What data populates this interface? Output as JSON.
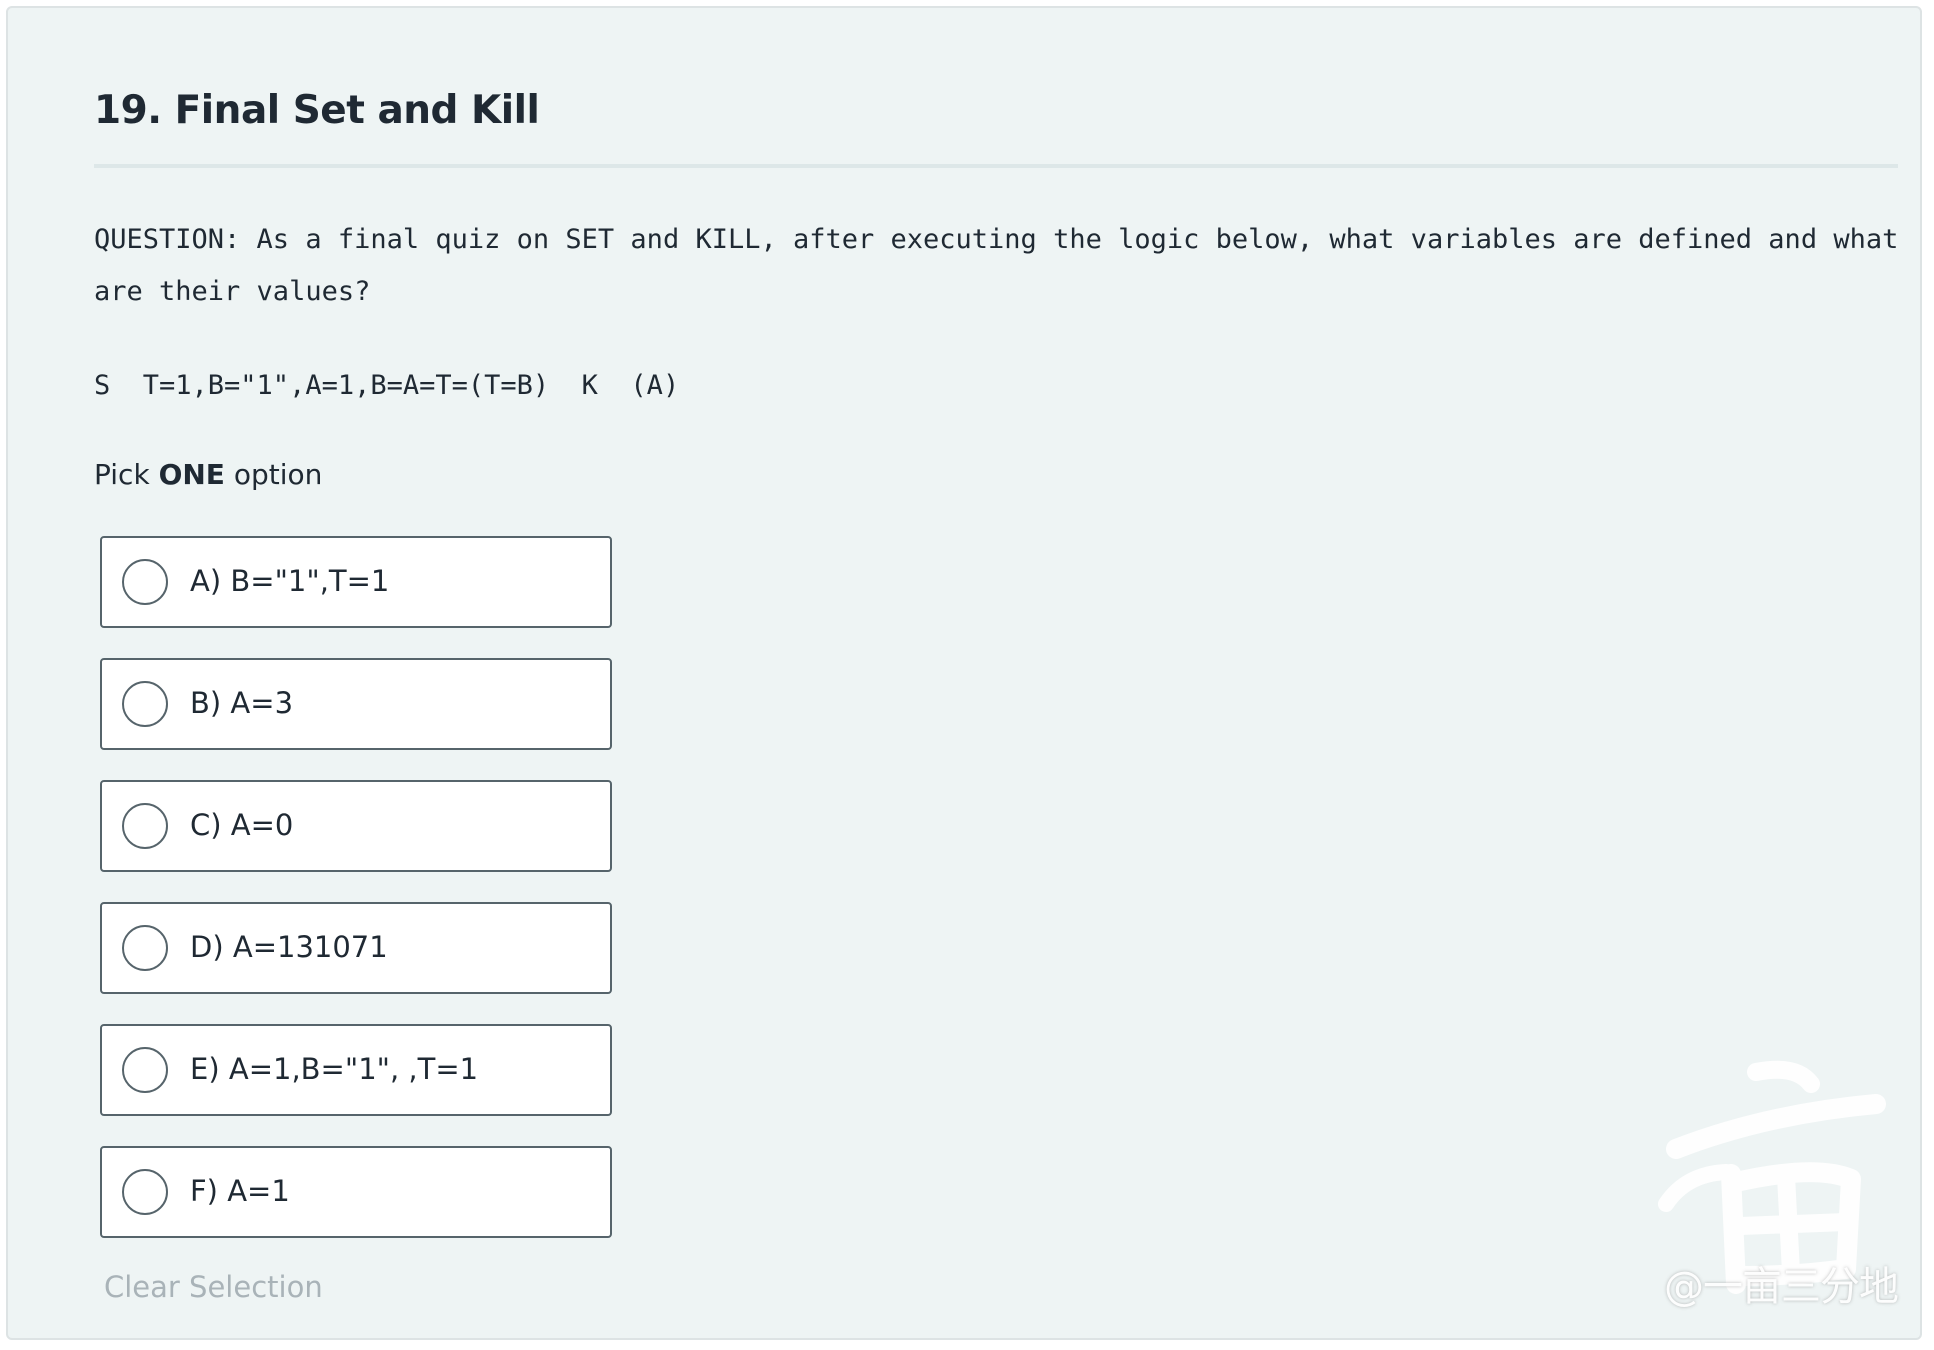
{
  "question": {
    "title": "19. Final Set and Kill",
    "text": "QUESTION: As a final quiz on SET and KILL, after executing the logic below, what variables are defined and what are their values?",
    "code": "S  T=1,B=\"1\",A=1,B=A=T=(T=B)  K  (A)"
  },
  "instructions": {
    "prefix": "Pick ",
    "emphasis": "ONE",
    "suffix": " option"
  },
  "options": [
    {
      "label": "A) B=\"1\",T=1"
    },
    {
      "label": "B) A=3"
    },
    {
      "label": "C) A=0"
    },
    {
      "label": "D) A=131071"
    },
    {
      "label": "E) A=1,B=\"1\", ,T=1"
    },
    {
      "label": "F) A=1"
    }
  ],
  "clear_label": "Clear Selection",
  "watermark": {
    "text": "@一亩三分地"
  },
  "colors": {
    "background": "#eef4f4",
    "option_border": "#56646b",
    "text": "#1f2933",
    "muted": "#a9b3b8"
  }
}
